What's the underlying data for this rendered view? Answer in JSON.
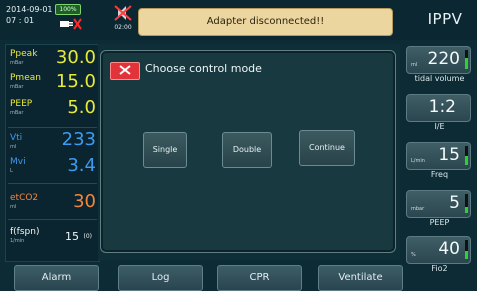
{
  "status": {
    "date": "2014-09-01",
    "time": "07 : 01",
    "battery": "100%",
    "alarm_time": "02:00",
    "alert": "Adapter disconnected!!",
    "mode": "IPPV"
  },
  "params": [
    {
      "label": "Ppeak",
      "unit": "mBar",
      "value": "30.0",
      "color": "#e7ea38"
    },
    {
      "label": "Pmean",
      "unit": "mBar",
      "value": "15.0",
      "color": "#e7ea38"
    },
    {
      "label": "PEEP",
      "unit": "mBar",
      "value": "5.0",
      "color": "#e7ea38"
    },
    {
      "label": "Vti",
      "unit": "ml",
      "value": "233",
      "color": "#3d9bf0"
    },
    {
      "label": "Mvi",
      "unit": "L",
      "value": "3.4",
      "color": "#3d9bf0"
    },
    {
      "label": "etCO2",
      "unit": "ml",
      "value": "30",
      "color": "#f2863c"
    },
    {
      "label": "f(fspn)",
      "unit": "1/min",
      "value": "15",
      "extra": "(0)",
      "color": "#f1f5f6"
    }
  ],
  "settings": [
    {
      "unit": "ml",
      "value": "220",
      "label": "tidal volume",
      "level": 0.6
    },
    {
      "unit": "",
      "value": "1:2",
      "label": "I/E",
      "level": null
    },
    {
      "unit": "L/min",
      "value": "15",
      "label": "Freq",
      "level": 0.5
    },
    {
      "unit": "mbar",
      "value": "5",
      "label": "PEEP",
      "level": 0.3
    },
    {
      "unit": "%",
      "value": "40",
      "label": "Fio2",
      "level": 0.4
    }
  ],
  "dialog": {
    "title": "Choose control mode",
    "options": [
      "Single",
      "Double",
      "Continue"
    ]
  },
  "bottom_buttons": [
    "Alarm",
    "Log",
    "CPR",
    "Ventilate"
  ],
  "colors": {
    "background": "#0c2b35",
    "alert_bg": "#ecd6a0",
    "close_red": "#e2333a",
    "level_green": "#2ed12e"
  },
  "icons": [
    "battery-icon",
    "power-plug-icon",
    "alarm-mute-icon",
    "close-icon"
  ]
}
